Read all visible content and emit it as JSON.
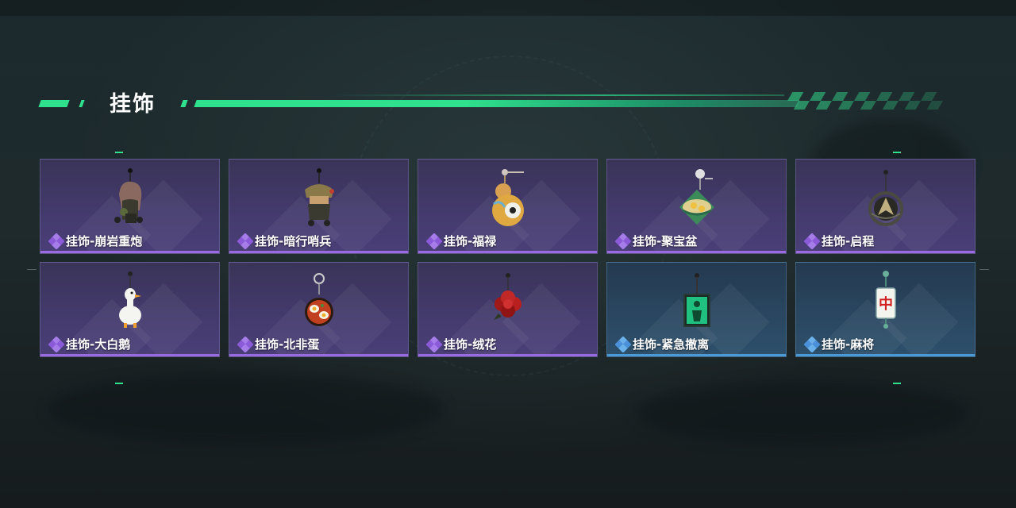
{
  "section": {
    "title": "挂饰"
  },
  "items": [
    {
      "label": "挂饰-崩岩重炮",
      "rarity": "purple",
      "icon": "rock-soldier-charm-icon"
    },
    {
      "label": "挂饰-暗行哨兵",
      "rarity": "purple",
      "icon": "camo-soldier-charm-icon"
    },
    {
      "label": "挂饰-福禄",
      "rarity": "purple",
      "icon": "gourd-charm-icon"
    },
    {
      "label": "挂饰-聚宝盆",
      "rarity": "purple",
      "icon": "treasure-bowl-charm-icon"
    },
    {
      "label": "挂饰-启程",
      "rarity": "purple",
      "icon": "emblem-charm-icon"
    },
    {
      "label": "挂饰-大白鹅",
      "rarity": "purple",
      "icon": "goose-charm-icon"
    },
    {
      "label": "挂饰-北非蛋",
      "rarity": "purple",
      "icon": "shakshuka-charm-icon"
    },
    {
      "label": "挂饰-绒花",
      "rarity": "purple",
      "icon": "red-flower-charm-icon"
    },
    {
      "label": "挂饰-紧急撤离",
      "rarity": "blue",
      "icon": "evac-sign-charm-icon"
    },
    {
      "label": "挂饰-麻将",
      "rarity": "blue",
      "icon": "mahjong-tile-charm-icon"
    }
  ],
  "mahjong_tile_text": "中",
  "colors": {
    "accent": "#2fe08c",
    "rarity_purple": "#9a6ae0",
    "rarity_blue": "#4a9ad8"
  }
}
